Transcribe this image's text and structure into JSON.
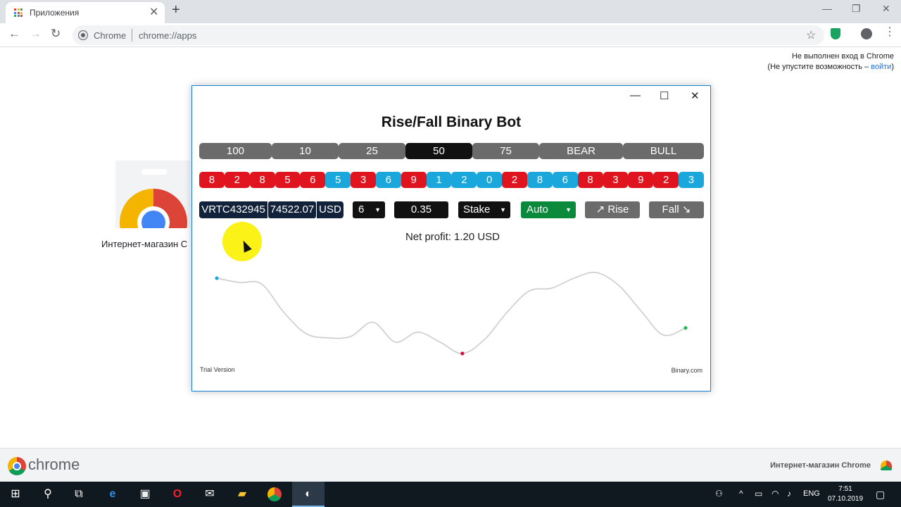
{
  "browser": {
    "tab_title": "Приложения",
    "tab_close": "✕",
    "new_tab": "+",
    "omnibox_origin": "Chrome",
    "omnibox_url": "chrome://apps",
    "win_minimize": "—",
    "win_restore": "❐",
    "win_close": "✕"
  },
  "signin": {
    "line1": "Не выполнен вход в Chrome",
    "line2_prefix": "(Не упустите возможность – ",
    "line2_link": "войти",
    "line2_suffix": ")"
  },
  "apps": {
    "webstore_label": "Интернет-магазин C"
  },
  "bot": {
    "title": "Rise/Fall Binary Bot",
    "tick_options": [
      {
        "label": "100",
        "active": false
      },
      {
        "label": "10",
        "active": false
      },
      {
        "label": "25",
        "active": false
      },
      {
        "label": "50",
        "active": true
      },
      {
        "label": "75",
        "active": false
      },
      {
        "label": "BEAR",
        "active": false
      },
      {
        "label": "BULL",
        "active": false
      }
    ],
    "digits": [
      {
        "d": "8",
        "c": "red"
      },
      {
        "d": "2",
        "c": "red"
      },
      {
        "d": "8",
        "c": "red"
      },
      {
        "d": "5",
        "c": "red"
      },
      {
        "d": "6",
        "c": "red"
      },
      {
        "d": "5",
        "c": "blue"
      },
      {
        "d": "3",
        "c": "red"
      },
      {
        "d": "6",
        "c": "blue"
      },
      {
        "d": "9",
        "c": "red"
      },
      {
        "d": "1",
        "c": "blue"
      },
      {
        "d": "2",
        "c": "blue"
      },
      {
        "d": "0",
        "c": "blue"
      },
      {
        "d": "2",
        "c": "red"
      },
      {
        "d": "8",
        "c": "blue"
      },
      {
        "d": "6",
        "c": "blue"
      },
      {
        "d": "8",
        "c": "red"
      },
      {
        "d": "3",
        "c": "red"
      },
      {
        "d": "9",
        "c": "red"
      },
      {
        "d": "2",
        "c": "red"
      },
      {
        "d": "3",
        "c": "blue"
      }
    ],
    "account_id": "VRTC432945",
    "balance": "74522.07",
    "currency": "USD",
    "ticks_value": "6",
    "stake_value": "0.35",
    "basis_value": "Stake",
    "mode_value": "Auto",
    "rise_label": "↗ Rise",
    "fall_label": "Fall ↘",
    "net_profit_label": "Net profit:",
    "net_profit_value": "1.20 USD",
    "trial_label": "Trial Version",
    "brand_label": "Binary.com"
  },
  "colors": {
    "digit_red": "#e0141e",
    "digit_blue": "#1aa7dc",
    "line": "#cccccc",
    "start_point": "#1aa7dc",
    "low_point": "#d0103a",
    "end_point": "#1db954"
  },
  "chart_data": {
    "type": "line",
    "series": [
      {
        "values": [
          71,
          68,
          67,
          47,
          32,
          29,
          30,
          40,
          26,
          33,
          26,
          18,
          28,
          47,
          62,
          64,
          71,
          75,
          66,
          48,
          31,
          36
        ]
      }
    ],
    "highlights": {
      "start_index": 0,
      "low_index": 11,
      "end_index": 21
    }
  },
  "footer": {
    "wordmark": "chrome",
    "store_label": "Интернет-магазин Chrome"
  },
  "taskbar": {
    "lang": "ENG",
    "time": "7:51",
    "date": "07.10.2019"
  }
}
